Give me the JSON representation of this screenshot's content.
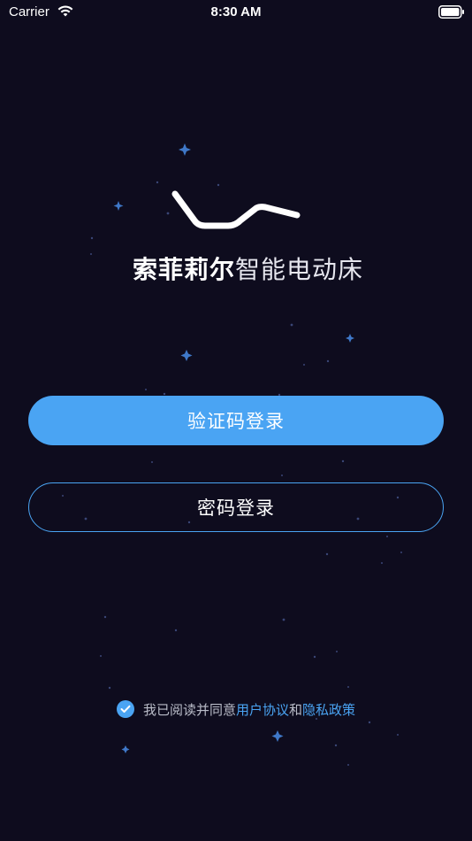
{
  "status_bar": {
    "carrier": "Carrier",
    "time": "8:30 AM",
    "wifi_icon": "wifi-icon",
    "battery_icon": "battery-icon"
  },
  "logo": {
    "brand_bold": "索菲莉尔",
    "brand_light": "智能电动床",
    "mark_icon": "bed-curve-logo"
  },
  "buttons": {
    "sms_login": "验证码登录",
    "password_login": "密码登录"
  },
  "agreement": {
    "checked": true,
    "prefix": "我已阅读并同意",
    "user_agreement": "用户协议",
    "and": "和",
    "privacy_policy": "隐私政策"
  },
  "colors": {
    "background": "#0e0c1e",
    "accent": "#4aa4f3",
    "muted_text": "#b9bcc8"
  }
}
